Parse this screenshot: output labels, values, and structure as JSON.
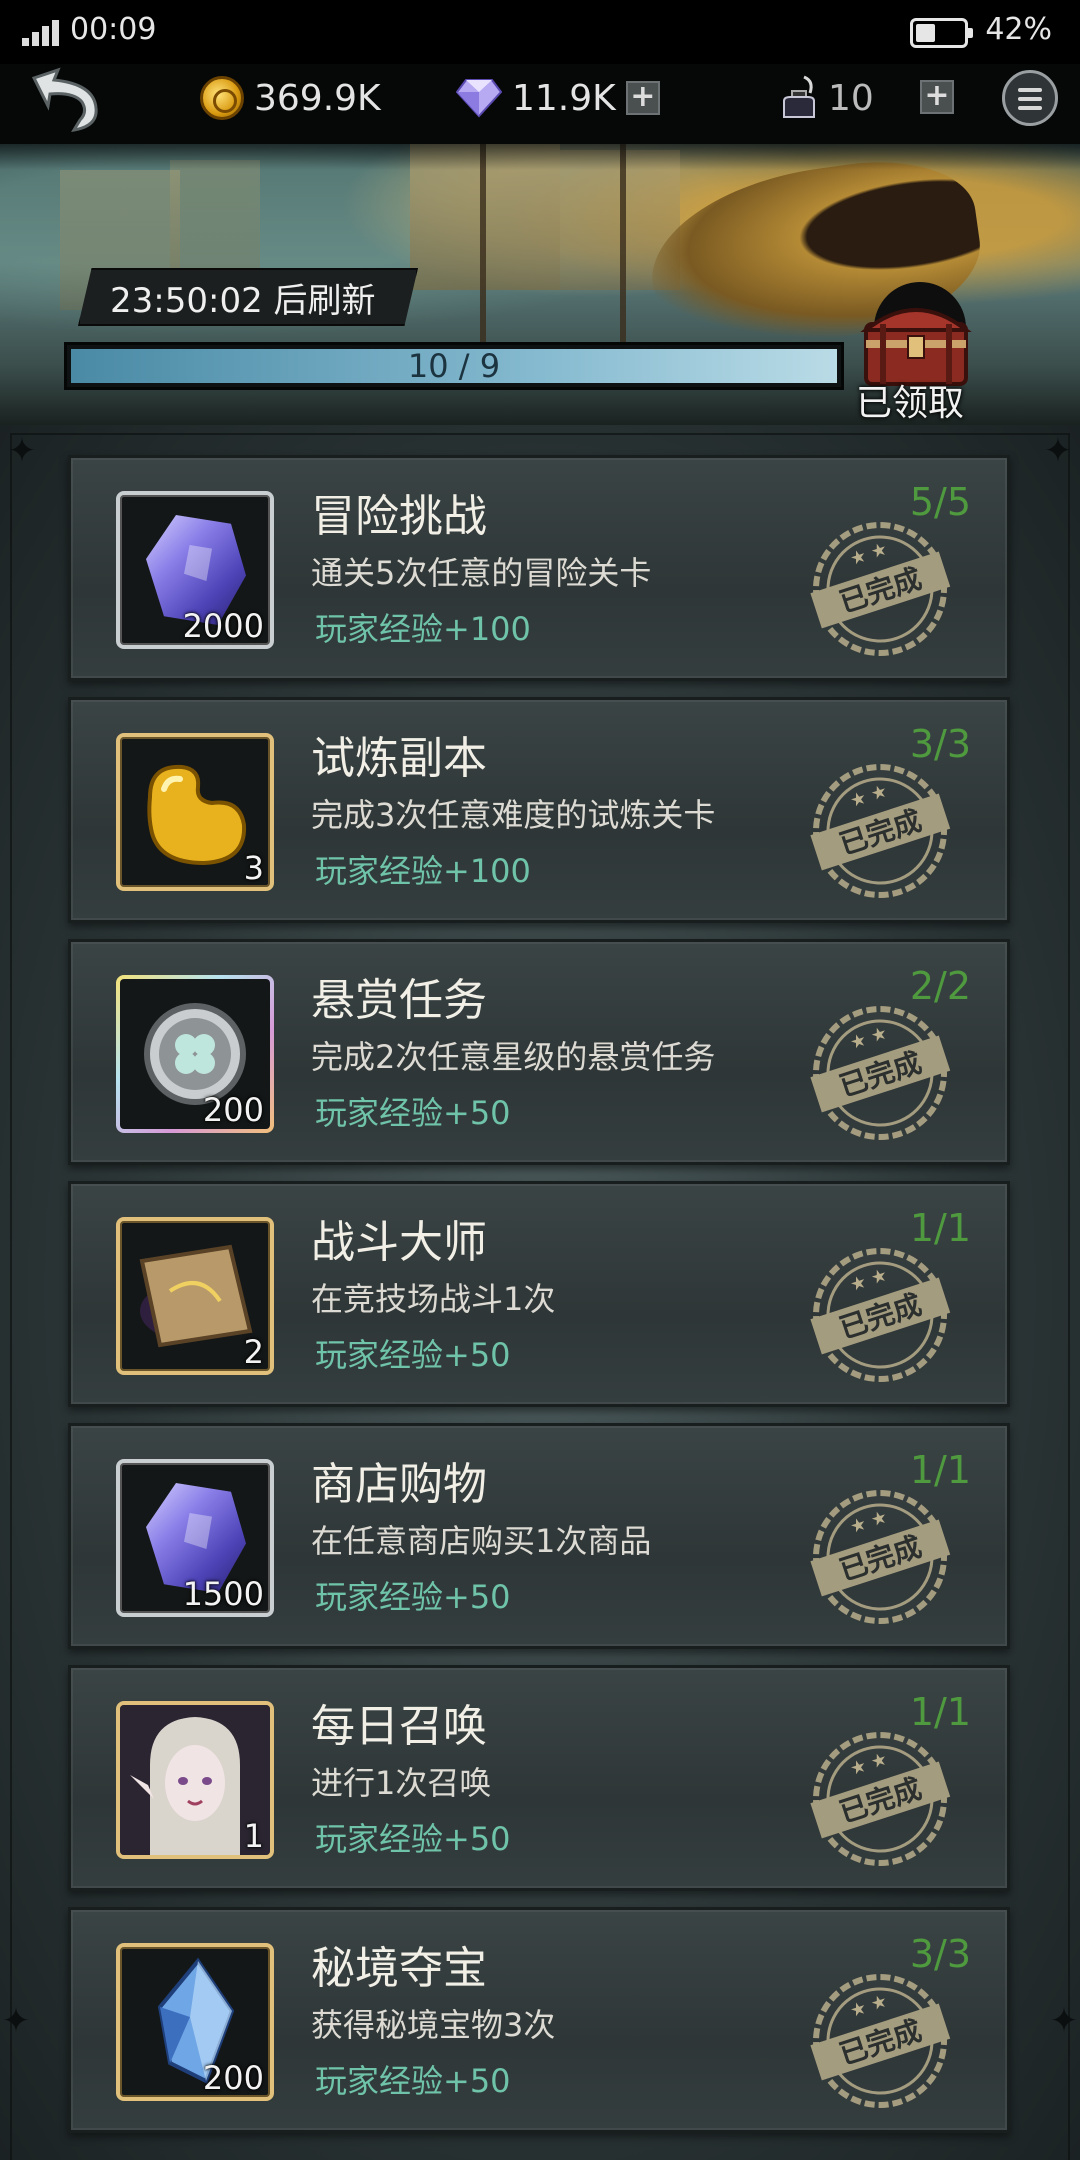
{
  "status_bar": {
    "time": "00:09",
    "battery_pct": "42%",
    "battery_level": 0.42
  },
  "resources": {
    "gold": "369.9K",
    "diamonds": "11.9K",
    "ink": "10"
  },
  "banner": {
    "refresh_timer": "23:50:02 后刷新",
    "progress_text": "10 / 9",
    "progress_fraction": 1.0,
    "chest_status": "已领取"
  },
  "quests": [
    {
      "title": "冒险挑战",
      "description": "通关5次任意的冒险关卡",
      "reward": "玩家经验+100",
      "progress": "5/5",
      "item_count": "2000",
      "icon": "purple-gem-icon",
      "frame": "silver",
      "status": "已完成"
    },
    {
      "title": "试炼副本",
      "description": "完成3次任意难度的试炼关卡",
      "reward": "玩家经验+100",
      "progress": "3/3",
      "item_count": "3",
      "icon": "golden-bean-icon",
      "frame": "gold",
      "status": "已完成"
    },
    {
      "title": "悬赏任务",
      "description": "完成2次任意星级的悬赏任务",
      "reward": "玩家经验+50",
      "progress": "2/2",
      "item_count": "200",
      "icon": "clover-coin-icon",
      "frame": "rainbow",
      "status": "已完成"
    },
    {
      "title": "战斗大师",
      "description": "在竞技场战斗1次",
      "reward": "玩家经验+50",
      "progress": "1/1",
      "item_count": "2",
      "icon": "scroll-icon",
      "frame": "gold",
      "status": "已完成"
    },
    {
      "title": "商店购物",
      "description": "在任意商店购买1次商品",
      "reward": "玩家经验+50",
      "progress": "1/1",
      "item_count": "1500",
      "icon": "purple-gem-icon",
      "frame": "silver",
      "status": "已完成"
    },
    {
      "title": "每日召唤",
      "description": "进行1次召唤",
      "reward": "玩家经验+50",
      "progress": "1/1",
      "item_count": "1",
      "icon": "elf-portrait-icon",
      "frame": "gold",
      "status": "已完成"
    },
    {
      "title": "秘境夺宝",
      "description": "获得秘境宝物3次",
      "reward": "玩家经验+50",
      "progress": "3/3",
      "item_count": "200",
      "icon": "blue-crystal-icon",
      "frame": "gold",
      "status": "已完成"
    }
  ],
  "colors": {
    "reward": "#6fc3a8",
    "progress_done": "#4f9a3e",
    "stamp": "#b9ae8c",
    "progress_bar": "#84b9cf"
  }
}
